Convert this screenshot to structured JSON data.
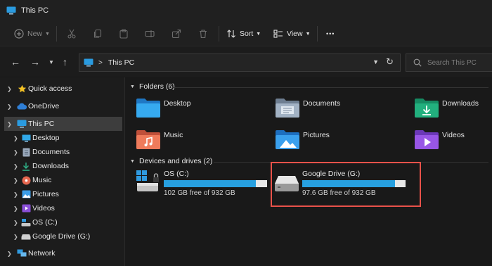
{
  "window": {
    "title": "This PC"
  },
  "commandbar": {
    "new_label": "New",
    "sort_label": "Sort",
    "view_label": "View",
    "more_label": "•••"
  },
  "address": {
    "crumb": "This PC",
    "separator": ">",
    "search_placeholder": "Search This PC"
  },
  "navpane": {
    "quick_access": "Quick access",
    "onedrive": "OneDrive",
    "this_pc": "This PC",
    "children": [
      "Desktop",
      "Documents",
      "Downloads",
      "Music",
      "Pictures",
      "Videos",
      "OS (C:)",
      "Google Drive (G:)"
    ],
    "network": "Network"
  },
  "folders": {
    "header": "Folders (6)",
    "items": [
      "Desktop",
      "Documents",
      "Downloads",
      "Music",
      "Pictures",
      "Videos"
    ]
  },
  "drives": {
    "header": "Devices and drives (2)",
    "items": [
      {
        "name": "OS (C:)",
        "free": "102 GB free of 932 GB",
        "used_fraction": 0.89
      },
      {
        "name": "Google Drive (G:)",
        "free": "97.6 GB free of 932 GB",
        "used_fraction": 0.9
      }
    ]
  },
  "colors": {
    "accent": "#27a0e0",
    "highlight_box": "#e8524a",
    "background": "#191919"
  }
}
